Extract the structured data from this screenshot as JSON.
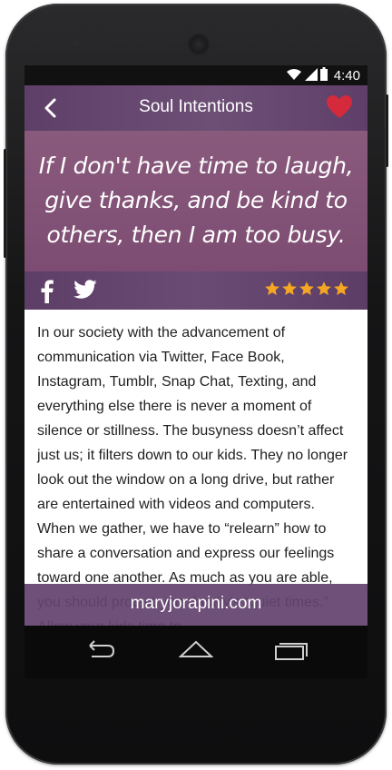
{
  "status_bar": {
    "time": "4:40",
    "wifi_icon": "wifi-icon",
    "signal_icon": "signal-icon",
    "battery_icon": "battery-icon"
  },
  "header": {
    "title": "Soul Intentions",
    "back_icon": "back-arrow-icon",
    "favorite_icon": "heart-icon"
  },
  "quote": {
    "text": "If I don't have time to laugh, give thanks, and be kind to others, then I am too busy."
  },
  "share": {
    "facebook_icon": "facebook-icon",
    "twitter_icon": "twitter-icon",
    "rating": 5,
    "rating_max": 5
  },
  "content": {
    "paragraph": "In our society with the advancement of communication via Twitter, Face Book, Instagram, Tumblr, Snap Chat, Texting, and everything else there is never a moment of silence or stillness. The busyness doesn’t affect just us; it filters down to our kids. They no longer look out the window on a long drive, but rather are entertained with videos and computers. When we gather, we have to “relearn” how to share a conversation and express our feelings toward one another. As much as you are able, you should protect your family’s “quiet times.” Allow your kids time to"
  },
  "footer": {
    "site": "maryjorapini.com"
  },
  "nav": {
    "back_icon": "back-nav-icon",
    "home_icon": "home-nav-icon",
    "recents_icon": "recents-nav-icon"
  },
  "colors": {
    "header": "#6a4b73",
    "quote_bg": "#7d4c72",
    "heart": "#d42a3c",
    "stars": "#f5a623"
  }
}
